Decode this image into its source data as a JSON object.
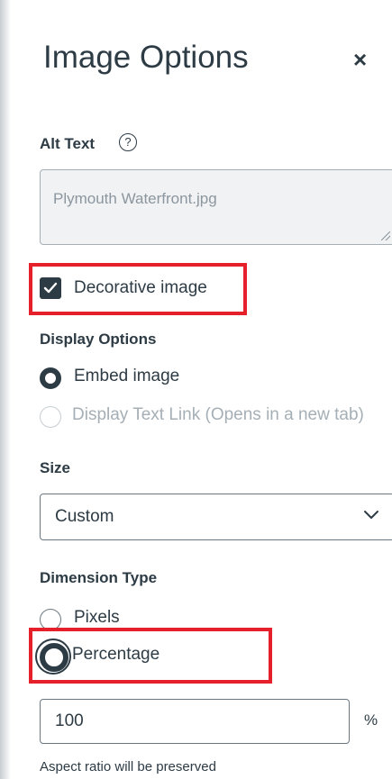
{
  "panel": {
    "title": "Image Options",
    "close_glyph": "×"
  },
  "alt_text": {
    "label": "Alt Text",
    "help_glyph": "?",
    "placeholder": "Plymouth Waterfront.jpg"
  },
  "decorative": {
    "label": "Decorative image",
    "checked": true
  },
  "display_options": {
    "label": "Display Options",
    "options": [
      {
        "label": "Embed image",
        "selected": true,
        "disabled": false
      },
      {
        "label": "Display Text Link (Opens in a new tab)",
        "selected": false,
        "disabled": true
      }
    ]
  },
  "size": {
    "label": "Size",
    "value": "Custom"
  },
  "dimension_type": {
    "label": "Dimension Type",
    "options": [
      {
        "label": "Pixels",
        "selected": false
      },
      {
        "label": "Percentage",
        "selected": true
      }
    ]
  },
  "dimension": {
    "value": "100",
    "unit": "%",
    "hint": "Aspect ratio will be preserved"
  },
  "colors": {
    "text": "#2d3b45",
    "highlight": "#e5202a",
    "disabled_text": "#a5afb5",
    "field_disabled_bg": "#f1f2f4"
  }
}
